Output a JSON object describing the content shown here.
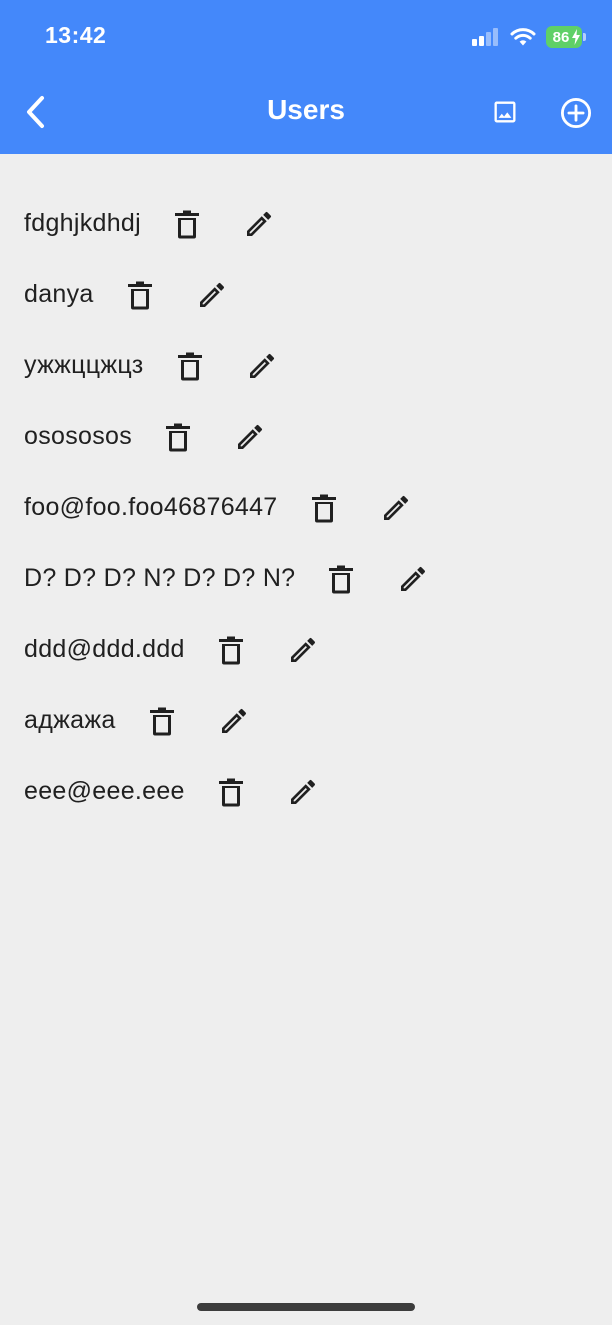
{
  "status_bar": {
    "time": "13:42",
    "battery_level": "86",
    "battery_color": "#5fd067"
  },
  "header": {
    "title": "Users",
    "background_color": "#4488fa",
    "back_icon": "chevron-left-icon",
    "image_icon": "image-icon",
    "add_icon": "add-circle-icon"
  },
  "users": [
    {
      "name": "fdghjkdhdj"
    },
    {
      "name": "danya"
    },
    {
      "name": "ужжццжцз"
    },
    {
      "name": "osososos"
    },
    {
      "name": "foo@foo.foo46876447"
    },
    {
      "name": "D? D? D? N? D? D? N?"
    },
    {
      "name": "ddd@ddd.ddd"
    },
    {
      "name": "аджажа"
    },
    {
      "name": "eee@eee.eee"
    }
  ],
  "row_icons": {
    "delete": "trash-icon",
    "edit": "pencil-icon"
  }
}
